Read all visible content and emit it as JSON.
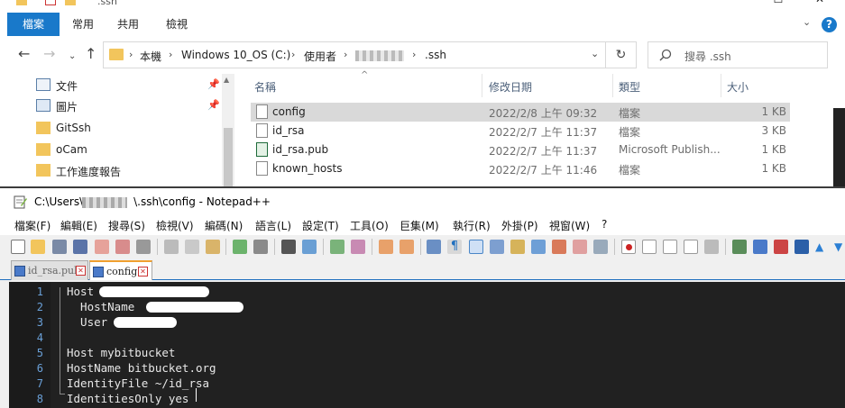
{
  "explorer": {
    "title": ".ssh",
    "ribbon_tabs": [
      "檔案",
      "常用",
      "共用",
      "檢視"
    ],
    "address": {
      "crumbs": [
        "本機",
        "Windows 10_OS (C:)",
        "使用者",
        ".ssh"
      ]
    },
    "search_placeholder": "搜尋 .ssh",
    "nav_items": [
      {
        "label": "文件",
        "icon": "document-folder-icon",
        "pinned": true
      },
      {
        "label": "圖片",
        "icon": "pictures-folder-icon",
        "pinned": true
      },
      {
        "label": "GitSsh",
        "icon": "folder-icon",
        "pinned": false
      },
      {
        "label": "oCam",
        "icon": "folder-icon",
        "pinned": false
      },
      {
        "label": "工作進度報告",
        "icon": "folder-icon",
        "pinned": false
      }
    ],
    "columns": {
      "name": "名稱",
      "date": "修改日期",
      "type": "類型",
      "size": "大小"
    },
    "files": [
      {
        "name": "config",
        "date": "2022/2/8 上午 09:32",
        "type": "檔案",
        "size": "1 KB",
        "selected": true
      },
      {
        "name": "id_rsa",
        "date": "2022/2/7 上午 11:37",
        "type": "檔案",
        "size": "3 KB",
        "selected": false
      },
      {
        "name": "id_rsa.pub",
        "date": "2022/2/7 上午 11:37",
        "type": "Microsoft Publish...",
        "size": "1 KB",
        "selected": false
      },
      {
        "name": "known_hosts",
        "date": "2022/2/7 上午 11:46",
        "type": "檔案",
        "size": "1 KB",
        "selected": false
      }
    ]
  },
  "notepad": {
    "title_prefix": "C:\\Users\\",
    "title_suffix": "\\.ssh\\config - Notepad++",
    "menu": [
      "檔案(F)",
      "編輯(E)",
      "搜尋(S)",
      "檢視(V)",
      "編碼(N)",
      "語言(L)",
      "設定(T)",
      "工具(O)",
      "巨集(M)",
      "執行(R)",
      "外掛(P)",
      "視窗(W)",
      "?"
    ],
    "tabs": [
      {
        "label": "id_rsa.pub",
        "active": false
      },
      {
        "label": "config",
        "active": true
      }
    ],
    "lines": [
      {
        "num": "1",
        "text": "Host "
      },
      {
        "num": "2",
        "text": "  HostName "
      },
      {
        "num": "3",
        "text": "  User "
      },
      {
        "num": "4",
        "text": ""
      },
      {
        "num": "5",
        "text": "Host mybitbucket"
      },
      {
        "num": "6",
        "text": "HostName bitbucket.org"
      },
      {
        "num": "7",
        "text": "IdentityFile ~/id_rsa"
      },
      {
        "num": "8",
        "text": "IdentitiesOnly yes"
      }
    ]
  },
  "colors": {
    "accent": "#1979ca",
    "editor_bg": "#212121",
    "line_number": "#6aa0d8",
    "selected_row": "#d9d9d9"
  }
}
